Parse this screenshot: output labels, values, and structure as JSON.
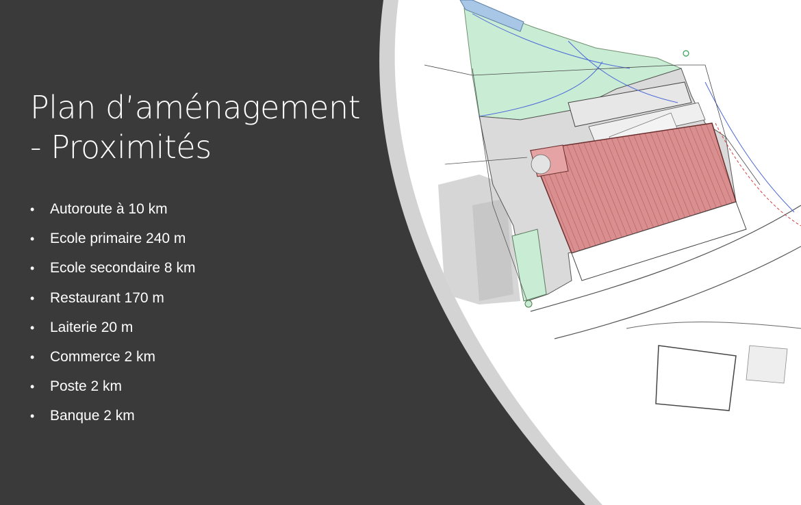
{
  "slide": {
    "title_line1": "Plan d’aménagement",
    "title_line2": "- Proximités",
    "bullets": [
      "Autoroute à 10 km",
      "Ecole primaire 240 m",
      "Ecole secondaire 8 km",
      "Restaurant 170 m",
      "Laiterie 20 m",
      "Commerce 2 km",
      "Poste 2 km",
      "Banque 2 km"
    ],
    "colors": {
      "background": "#3a3a3a",
      "panel": "#ffffff",
      "ring": "#d3d3d3",
      "roof": "#d78a8a",
      "green_area": "#c9ecd4",
      "paved": "#d8d8d8"
    },
    "image": {
      "name": "site-plan-image"
    }
  }
}
